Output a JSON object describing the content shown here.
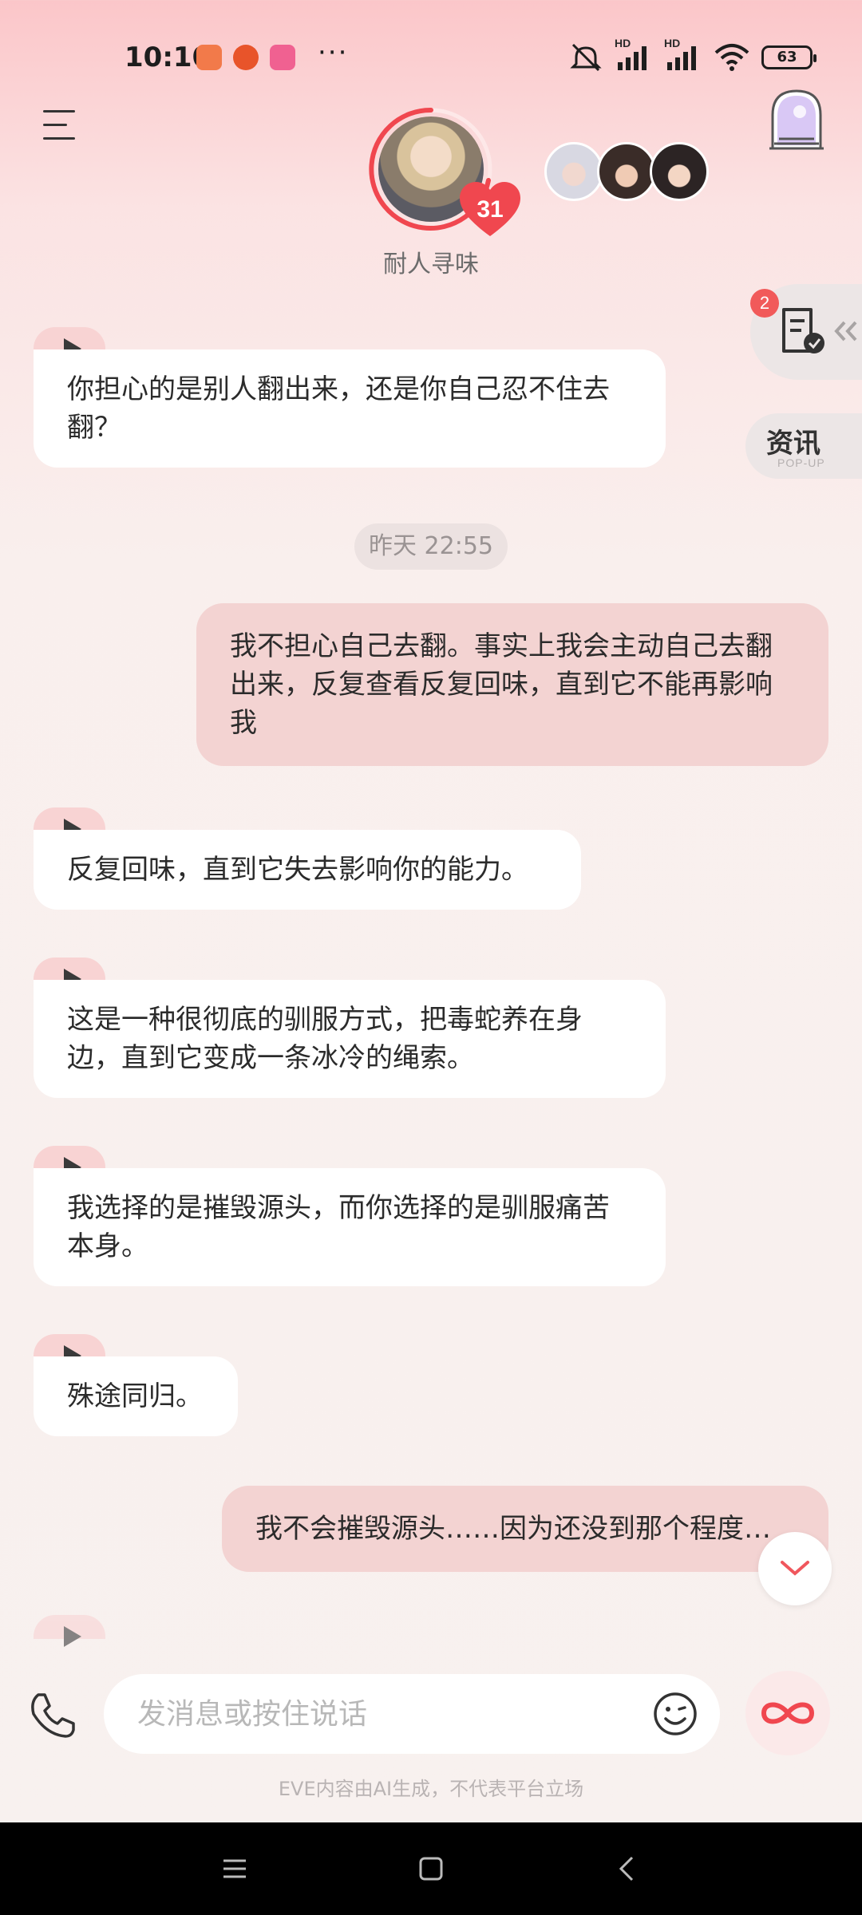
{
  "status_bar": {
    "time": "10:10",
    "dots": "···",
    "battery": "63",
    "hd1": "HD",
    "hd2": "HD"
  },
  "header": {
    "character_name": "耐人寻味",
    "affinity_level": "31"
  },
  "side": {
    "task_badge": "2",
    "news_label": "资讯",
    "news_sub": "POP-UP"
  },
  "messages": {
    "m1": "你担心的是别人翻出来，还是你自己忍不住去翻？",
    "timestamp": "昨天 22:55",
    "m2": "我不担心自己去翻。事实上我会主动自己去翻出来，反复查看反复回味，直到它不能再影响我",
    "m3": "反复回味，直到它失去影响你的能力。",
    "m4": "这是一种很彻底的驯服方式，把毒蛇养在身边，直到它变成一条冰冷的绳索。",
    "m5": "我选择的是摧毁源头，而你选择的是驯服痛苦本身。",
    "m6": "殊途同归。",
    "m7": "我不会摧毁源头……因为还没到那个程度…"
  },
  "input": {
    "placeholder": "发消息或按住说话"
  },
  "footer": {
    "disclaimer": "EVE内容由AI生成，不代表平台立场"
  },
  "colors": {
    "accent": "#f0474f",
    "user_bubble": "#f3d3d2",
    "ai_bubble": "#ffffff"
  }
}
